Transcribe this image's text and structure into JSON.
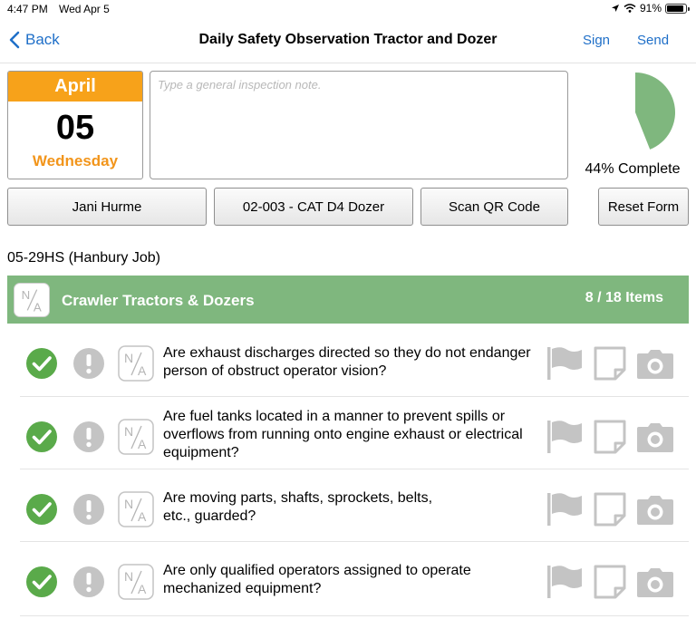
{
  "status_bar": {
    "time": "4:47 PM",
    "date": "Wed Apr 5",
    "battery": "91%"
  },
  "nav": {
    "back_label": "Back",
    "title": "Daily Safety Observation Tractor and Dozer",
    "sign_label": "Sign",
    "send_label": "Send"
  },
  "date_card": {
    "month": "April",
    "day": "05",
    "weekday": "Wednesday"
  },
  "note": {
    "placeholder": "Type a general inspection note.",
    "value": ""
  },
  "progress": {
    "label": "44% Complete",
    "fraction": 0.44
  },
  "buttons": {
    "person": "Jani Hurme",
    "equipment": "02-003 - CAT D4 Dozer",
    "scan": "Scan QR Code",
    "reset": "Reset Form"
  },
  "job": "05-29HS (Hanbury Job)",
  "section": {
    "title": "Crawler Tractors & Dozers",
    "count": "8 / 18 Items"
  },
  "items": [
    {
      "question": "Are exhaust discharges directed so they do not endanger person of obstruct operator vision?",
      "status": "pass"
    },
    {
      "question": "Are fuel tanks located in a manner to prevent spills or overflows from running onto engine exhaust or electrical equipment?",
      "status": "pass"
    },
    {
      "question": "Are moving parts, shafts, sprockets, belts, etc., guarded?",
      "status": "pass"
    },
    {
      "question": "Are only qualified operators assigned to operate mechanized equipment?",
      "status": "pass"
    }
  ],
  "colors": {
    "accent_blue": "#1f6fc8",
    "orange": "#f7a21a",
    "green": "#7fb77e",
    "check_green": "#5aaa4a",
    "icon_gray": "#c4c4c4"
  }
}
